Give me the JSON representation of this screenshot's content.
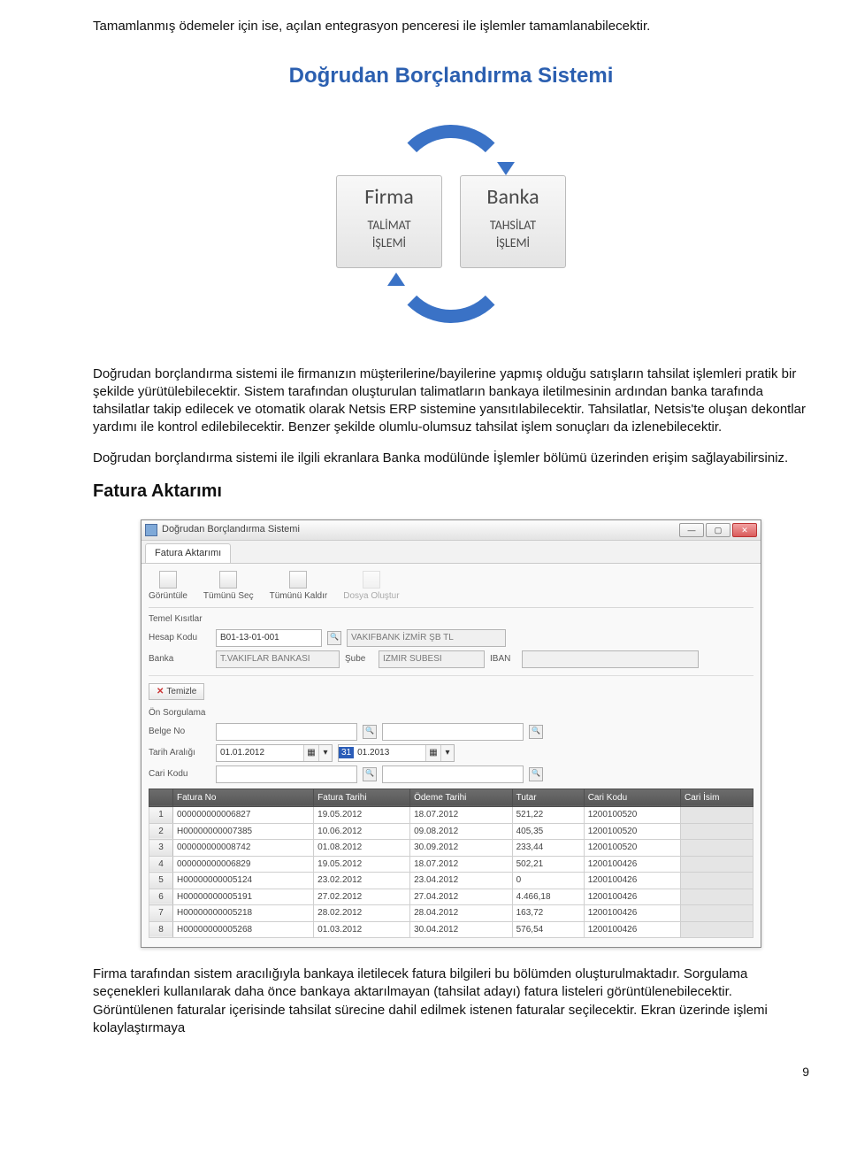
{
  "intro": "Tamamlanmış ödemeler için ise, açılan entegrasyon penceresi ile işlemler tamamlanabilecektir.",
  "section_title": "Doğrudan Borçlandırma Sistemi",
  "diagram": {
    "left": {
      "title": "Firma",
      "l1": "TALİMAT",
      "l2": "İŞLEMİ"
    },
    "right": {
      "title": "Banka",
      "l1": "TAHSİLAT",
      "l2": "İŞLEMİ"
    }
  },
  "p1": "Doğrudan borçlandırma sistemi ile firmanızın müşterilerine/bayilerine yapmış olduğu satışların tahsilat işlemleri pratik bir şekilde yürütülebilecektir. Sistem tarafından oluşturulan talimatların bankaya iletilmesinin ardından banka tarafında tahsilatlar takip edilecek ve otomatik olarak Netsis ERP sistemine yansıtılabilecektir. Tahsilatlar, Netsis'te oluşan dekontlar yardımı ile kontrol edilebilecektir. Benzer şekilde olumlu-olumsuz tahsilat işlem sonuçları da izlenebilecektir.",
  "p2": "Doğrudan borçlandırma sistemi ile ilgili ekranlara Banka modülünde İşlemler bölümü üzerinden erişim sağlayabilirsiniz.",
  "subheading": "Fatura Aktarımı",
  "window": {
    "title": "Doğrudan Borçlandırma Sistemi",
    "tab": "Fatura Aktarımı",
    "toolbar": {
      "goruntule": "Görüntüle",
      "tumunu_sec": "Tümünü Seç",
      "tumunu_kaldir": "Tümünü Kaldır",
      "dosya_olustur": "Dosya Oluştur"
    },
    "group_temel": "Temel Kısıtlar",
    "labels": {
      "hesap_kodu": "Hesap Kodu",
      "banka": "Banka",
      "sube": "Şube",
      "iban": "IBAN"
    },
    "fields": {
      "hesap_kodu": "B01-13-01-001",
      "hesap_adi": "VAKIFBANK İZMİR ŞB TL",
      "banka": "T.VAKIFLAR BANKASI",
      "sube": "IZMIR SUBESI",
      "iban": ""
    },
    "clear": "Temizle",
    "group_on": "Ön Sorgulama",
    "labels2": {
      "belge_no": "Belge No",
      "tarih_araligi": "Tarih Aralığı",
      "cari_kodu": "Cari Kodu"
    },
    "dates": {
      "from": "01.01.2012",
      "to": "01.2013",
      "day": "31"
    },
    "grid": {
      "headers": [
        "Fatura No",
        "Fatura Tarihi",
        "Ödeme Tarihi",
        "Tutar",
        "Cari Kodu",
        "Cari İsim"
      ],
      "rows": [
        [
          "1",
          "000000000006827",
          "19.05.2012",
          "18.07.2012",
          "521,22",
          "1200100520",
          ""
        ],
        [
          "2",
          "H00000000007385",
          "10.06.2012",
          "09.08.2012",
          "405,35",
          "1200100520",
          ""
        ],
        [
          "3",
          "000000000008742",
          "01.08.2012",
          "30.09.2012",
          "233,44",
          "1200100520",
          ""
        ],
        [
          "4",
          "000000000006829",
          "19.05.2012",
          "18.07.2012",
          "502,21",
          "1200100426",
          ""
        ],
        [
          "5",
          "H00000000005124",
          "23.02.2012",
          "23.04.2012",
          "0",
          "1200100426",
          ""
        ],
        [
          "6",
          "H00000000005191",
          "27.02.2012",
          "27.04.2012",
          "4.466,18",
          "1200100426",
          ""
        ],
        [
          "7",
          "H00000000005218",
          "28.02.2012",
          "28.04.2012",
          "163,72",
          "1200100426",
          ""
        ],
        [
          "8",
          "H00000000005268",
          "01.03.2012",
          "30.04.2012",
          "576,54",
          "1200100426",
          ""
        ]
      ]
    }
  },
  "p3": "Firma tarafından sistem aracılığıyla bankaya iletilecek fatura bilgileri bu bölümden oluşturulmaktadır. Sorgulama seçenekleri kullanılarak daha önce bankaya aktarılmayan (tahsilat adayı) fatura listeleri görüntülenebilecektir. Görüntülenen faturalar içerisinde tahsilat sürecine dahil edilmek istenen faturalar seçilecektir. Ekran üzerinde işlemi kolaylaştırmaya",
  "page_number": "9"
}
